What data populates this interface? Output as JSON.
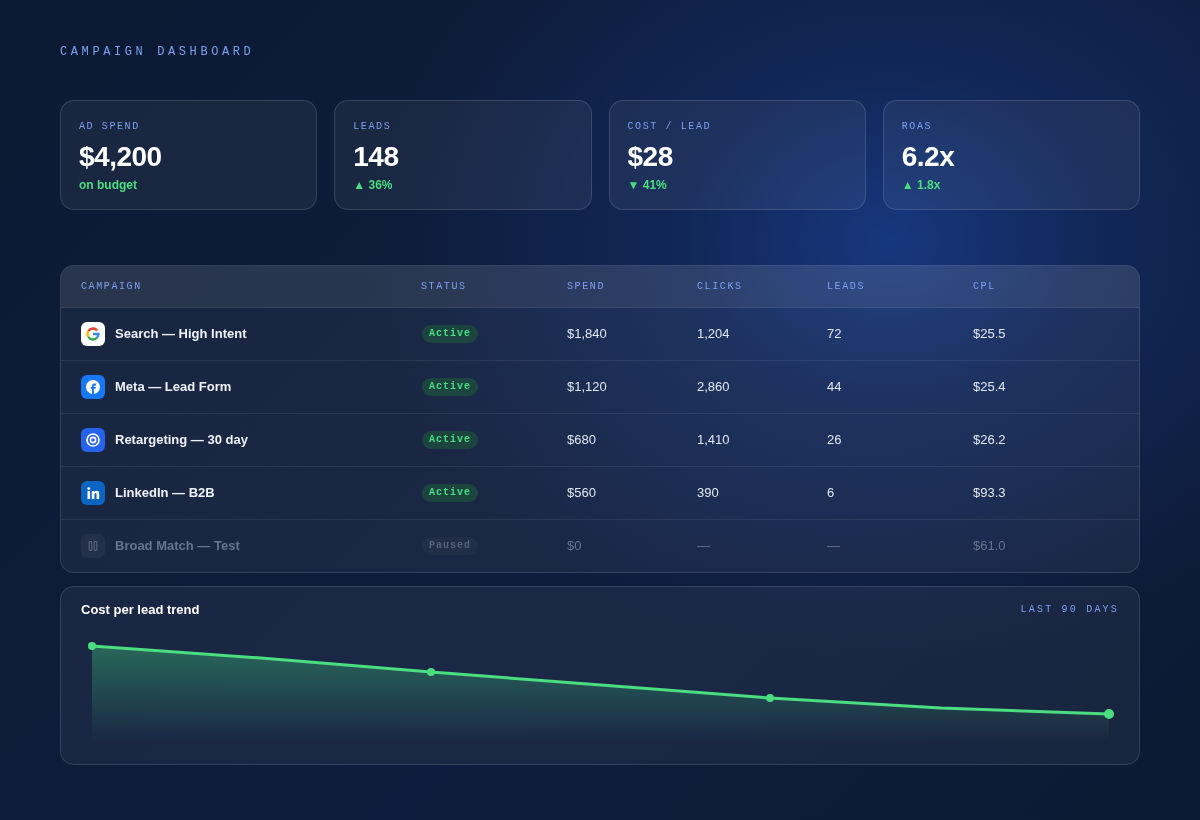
{
  "title": "CAMPAIGN DASHBOARD",
  "kpis": [
    {
      "label": "AD SPEND",
      "value": "$4,200",
      "delta": "on budget"
    },
    {
      "label": "LEADS",
      "value": "148",
      "delta": "▲ 36%"
    },
    {
      "label": "COST / LEAD",
      "value": "$28",
      "delta": "▼ 41%"
    },
    {
      "label": "ROAS",
      "value": "6.2x",
      "delta": "▲ 1.8x"
    }
  ],
  "table": {
    "columns": [
      "CAMPAIGN",
      "STATUS",
      "SPEND",
      "CLICKS",
      "LEADS",
      "CPL"
    ],
    "rows": [
      {
        "campaign": "Search — High Intent",
        "status": "Active",
        "spend": "$1,840",
        "clicks": "1,204",
        "leads": "72",
        "cpl": "$25.5",
        "muted": false
      },
      {
        "campaign": "Meta — Lead Form",
        "status": "Active",
        "spend": "$1,120",
        "clicks": "2,860",
        "leads": "44",
        "cpl": "$25.4",
        "muted": false
      },
      {
        "campaign": "Retargeting — 30 day",
        "status": "Active",
        "spend": "$680",
        "clicks": "1,410",
        "leads": "26",
        "cpl": "$26.2",
        "muted": false
      },
      {
        "campaign": "LinkedIn — B2B",
        "status": "Active",
        "spend": "$560",
        "clicks": "390",
        "leads": "6",
        "cpl": "$93.3",
        "muted": false
      },
      {
        "campaign": "Broad Match — Test",
        "status": "Paused",
        "spend": "$0",
        "clicks": "—",
        "leads": "—",
        "cpl": "$61.0",
        "muted": true
      }
    ]
  },
  "trend": {
    "title": "Cost per lead trend",
    "range": "LAST 90 DAYS"
  }
}
